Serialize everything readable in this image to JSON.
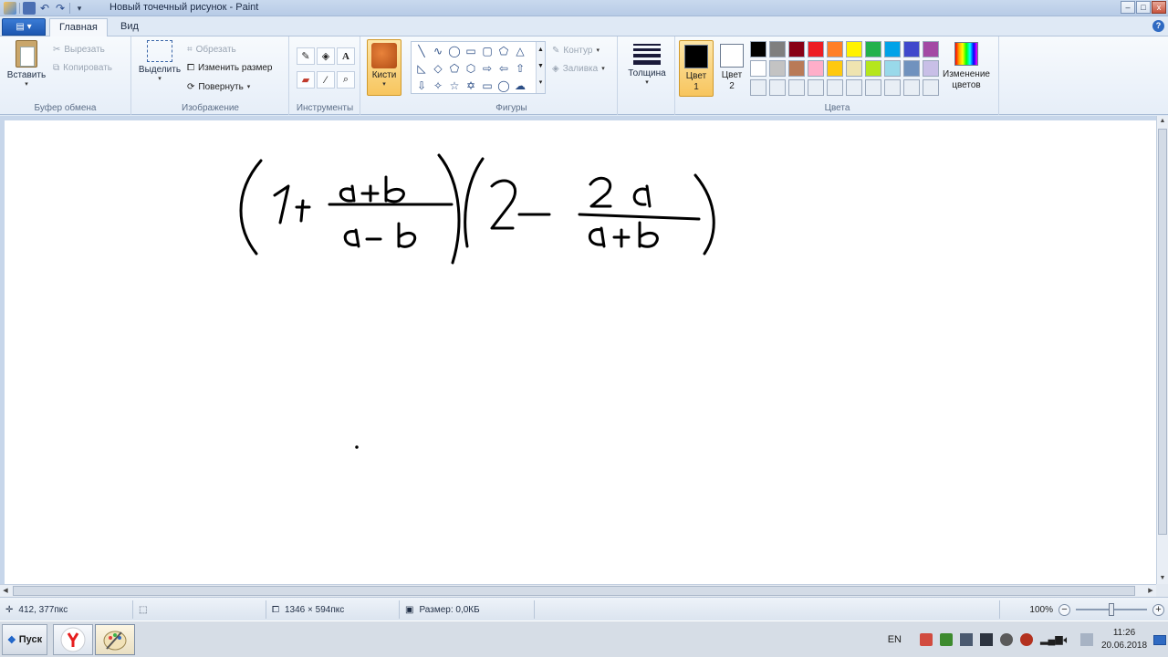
{
  "window": {
    "title": "Новый точечный рисунок - Paint",
    "buttons": {
      "minimize": "–",
      "maximize": "□",
      "close": "x"
    }
  },
  "tabs": {
    "file_label": "▤ ▾",
    "home": "Главная",
    "view": "Вид",
    "help": "?"
  },
  "clipboard": {
    "paste": "Вставить",
    "cut": "Вырезать",
    "copy": "Копировать",
    "group": "Буфер обмена"
  },
  "image": {
    "select": "Выделить",
    "crop": "Обрезать",
    "resize": "Изменить размер",
    "rotate": "Повернуть",
    "group": "Изображение"
  },
  "tools": {
    "group": "Инструменты",
    "text_glyph": "A"
  },
  "brushes": {
    "label": "Кисти"
  },
  "shapes": {
    "outline": "Контур",
    "fill": "Заливка",
    "group": "Фигуры"
  },
  "size": {
    "label": "Толщина"
  },
  "colors": {
    "color1_line1": "Цвет",
    "color1_line2": "1",
    "color2_line1": "Цвет",
    "color2_line2": "2",
    "edit_line1": "Изменение",
    "edit_line2": "цветов",
    "group": "Цвета",
    "color1_value": "#000000",
    "color2_value": "#ffffff",
    "palette": [
      "#000000",
      "#7f7f7f",
      "#880015",
      "#ed1c24",
      "#ff7f27",
      "#fff200",
      "#22b14c",
      "#00a2e8",
      "#3f48cc",
      "#a349a4",
      "#ffffff",
      "#c3c3c3",
      "#b97a57",
      "#ffaec9",
      "#ffc90e",
      "#efe4b0",
      "#b5e61d",
      "#99d9ea",
      "#7092be",
      "#c8bfe7",
      "#e8eef5",
      "#e8eef5",
      "#e8eef5",
      "#e8eef5",
      "#e8eef5",
      "#e8eef5",
      "#e8eef5",
      "#e8eef5",
      "#e8eef5",
      "#e8eef5"
    ]
  },
  "status": {
    "cursor_pos": "412, 377пкс",
    "image_size": "1346 × 594пкс",
    "file_size": "Размер: 0,0КБ",
    "zoom": "100%"
  },
  "taskbar": {
    "start": "Пуск",
    "lang": "EN",
    "time": "11:26",
    "date": "20.06.2018"
  }
}
